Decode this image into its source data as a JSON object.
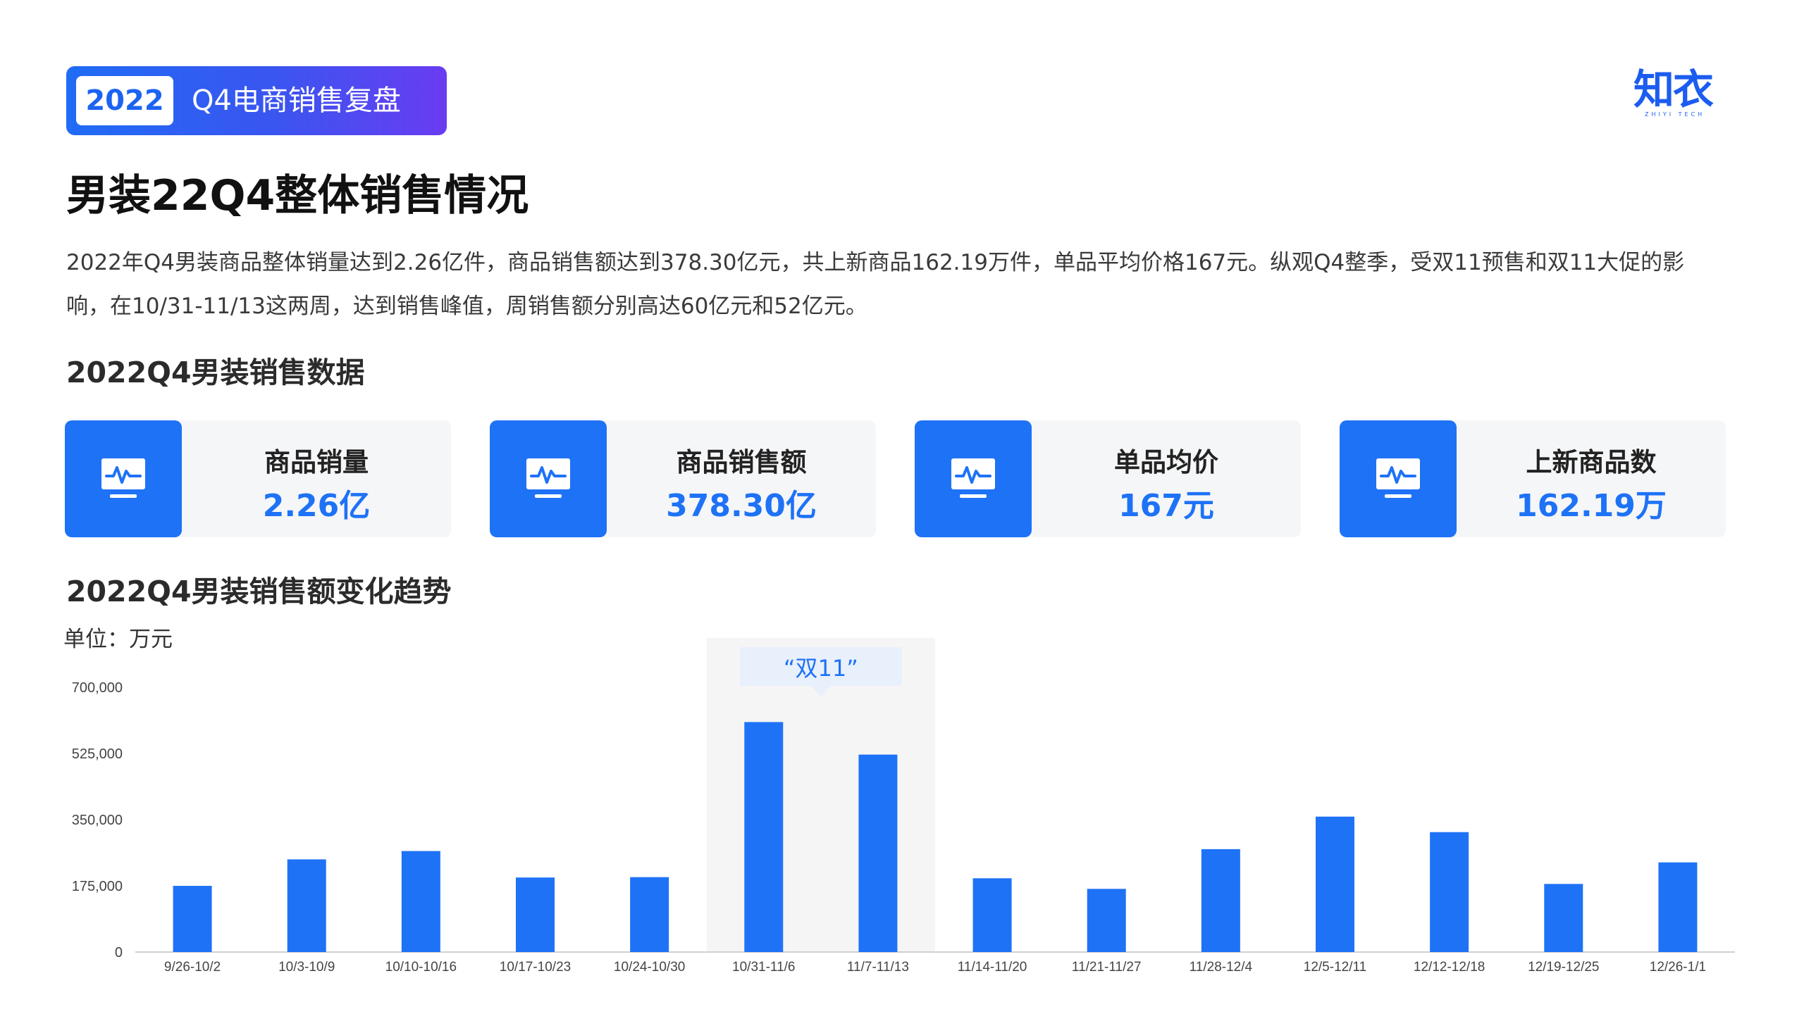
{
  "header": {
    "year": "2022",
    "badge_text": "Q4电商销售复盘"
  },
  "logo": {
    "mark": "知衣",
    "sub": "ZHIYI TECH"
  },
  "page_title": "男装22Q4整体销售情况",
  "intro": "2022年Q4男装商品整体销量达到2.26亿件，商品销售额达到378.30亿元，共上新商品162.19万件，单品平均价格167元。纵观Q4整季，受双11预售和双11大促的影响，在10/31-11/13这两周，达到销售峰值，周销售额分别高达60亿元和52亿元。",
  "section1_title": "2022Q4男装销售数据",
  "stats": [
    {
      "label": "商品销量",
      "value": "2.26亿",
      "icon": "monitor-pulse-icon"
    },
    {
      "label": "商品销售额",
      "value": "378.30亿",
      "icon": "monitor-pulse-icon"
    },
    {
      "label": "单品均价",
      "value": "167元",
      "icon": "monitor-pulse-icon"
    },
    {
      "label": "上新商品数",
      "value": "162.19万",
      "icon": "monitor-pulse-icon"
    }
  ],
  "section2_title": "2022Q4男装销售额变化趋势",
  "unit_label": "单位：万元",
  "colors": {
    "accent": "#1e72f6",
    "highlight_bg": "#f5f5f5",
    "callout_bg": "#e8f0fc"
  },
  "chart_data": {
    "type": "bar",
    "categories": [
      "9/26-10/2",
      "10/3-10/9",
      "10/10-10/16",
      "10/17-10/23",
      "10/24-10/30",
      "10/31-11/6",
      "11/7-11/13",
      "11/14-11/20",
      "11/21-11/27",
      "11/28-12/4",
      "12/5-12/11",
      "12/12-12/18",
      "12/19-12/25",
      "12/26-1/1"
    ],
    "values": [
      175000,
      245000,
      267000,
      197000,
      198000,
      608000,
      522000,
      195000,
      167000,
      272000,
      358000,
      317000,
      180000,
      237000
    ],
    "y_ticks": [
      0,
      175000,
      350000,
      525000,
      700000
    ],
    "y_tick_labels": [
      "0",
      "175,000",
      "350,000",
      "525,000",
      "700,000"
    ],
    "ylim": [
      0,
      700000
    ],
    "highlight_categories": [
      "10/31-11/6",
      "11/7-11/13"
    ],
    "annotation": "“双11”",
    "grid": false
  }
}
